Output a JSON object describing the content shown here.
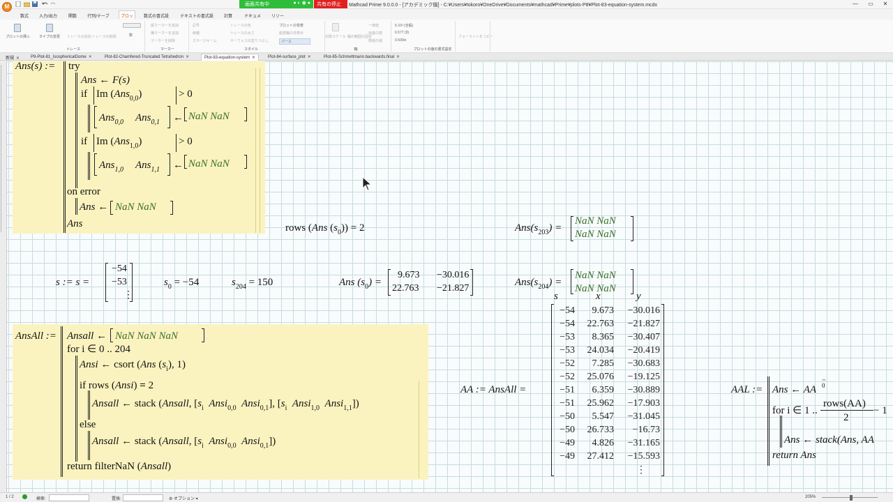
{
  "window": {
    "sharing_label": "画面共有中",
    "stop_sharing_label": "共有の停止",
    "title": "Mathcad Prime 9.0.0.0 - [アカデミック版] - C:¥Users¥tokoro¥OneDrive¥Documents¥mathcad¥Prime¥plots-P8¥Plot-83-equation-system.mcdx"
  },
  "ribbon_tabs": [
    "数式",
    "入力/出力",
    "関数",
    "行列/テーブル",
    "プロット",
    "数式の書式設定",
    "テキストの書式設定",
    "計算",
    "ドキュメント",
    "リソース"
  ],
  "active_ribbon_tab": "プロット",
  "ribbon": {
    "insert_plot": "プロットの挿入",
    "change_type": "タイプの変更",
    "add_trace": "トレースの追加",
    "remove_trace": "トレースの削除",
    "trace_group": "トレース",
    "number_label": "数",
    "add_vmarker": "縦マーカーを追加",
    "add_hmarker": "横マーカーを追加",
    "delete_marker": "マーカーを削除",
    "marker_group": "マーカー",
    "col1": [
      "記号",
      "線種",
      "カラースキーム"
    ],
    "col2": [
      "トレースの色",
      "トレースの太さ",
      "サーフェスの塗りつぶし"
    ],
    "style_group": "スタイル",
    "plot_bg": "プロットの背景",
    "bg_hide": "座標軸の非表示",
    "parse": "パース",
    "logscale": "対数スケール",
    "scale_fixed": "軸の範囲の固定",
    "col3": [
      "一様値",
      "目盛の数",
      "数値の値"
    ],
    "scale_group": "軸",
    "precision": "5-10³ (全般)",
    "value1": "6.577 (9)",
    "value2": "0.500in",
    "format_group": "プロットの値の書式設定",
    "format_copy": "フォーマットをコピー"
  },
  "doc_tabs": [
    "新規",
    "P9-Plot-81_IsosphericalDome",
    "Plot-82-Chamfered-Truncated Tetrahedron",
    "Plot-83-equation-system",
    "Plot-84-surface_plot",
    "Plot-85-Schmettmann.backwards.final"
  ],
  "active_doc_tab": "Plot-83-equation-system",
  "math": {
    "ans_def": "Ans(s) :=",
    "try": "try",
    "ans_assign": "Ans ← F(s)",
    "if_label": "if",
    "im_label": "Im",
    "ans_word": "Ans",
    "gt_zero": "> 0",
    "nan_pair": "NaN  NaN",
    "nan": "NaN",
    "sub00": "0,0",
    "sub01": "0,1",
    "sub10": "1,0",
    "sub11": "1,1",
    "on_error": "on error",
    "ans_final": "Ans",
    "rows_expr": "rows(Ans(s₀)) = 2",
    "ans203_label": "Ans(s",
    "ans203_sub": "203",
    "ans204_sub": "204",
    "s_def": "s := s =",
    "s_vec": [
      "−54",
      "−53",
      "⋮"
    ],
    "s0_eq": "= −54",
    "s204_eq": "= 150",
    "ans_s0_matrix": [
      [
        "9.673",
        "−30.016"
      ],
      [
        "22.763",
        "−21.827"
      ]
    ],
    "ansall_def": "AnsAll :=",
    "ansall_init": "Ansall ← [NaN  NaN  NaN]",
    "for_loop": "for i ∈ 0 .. 204",
    "ansi_assign": "Ansi ← csort(Ans(s",
    "ansi_tail": "), 1)",
    "if_rows": "if rows(Ansi) = 2",
    "stack1": "Ansall ← stack(Ansall, [s",
    "stack2": "Ansall ← stack(Ansall, [s",
    "ansi_word": "Ansi",
    "else": "else",
    "return_filter": "return filterNaN(Ansall)",
    "aa_def": "AA := AnsAll =",
    "col_headers": [
      "s",
      "x",
      "y"
    ],
    "aa_rows": [
      [
        "−54",
        "9.673",
        "−30.016"
      ],
      [
        "−54",
        "22.763",
        "−21.827"
      ],
      [
        "−53",
        "8.365",
        "−30.407"
      ],
      [
        "−53",
        "24.034",
        "−20.419"
      ],
      [
        "−52",
        "7.285",
        "−30.683"
      ],
      [
        "−52",
        "25.076",
        "−19.125"
      ],
      [
        "−51",
        "6.359",
        "−30.889"
      ],
      [
        "−51",
        "25.962",
        "−17.903"
      ],
      [
        "−50",
        "5.547",
        "−31.045"
      ],
      [
        "−50",
        "26.733",
        "−16.73"
      ],
      [
        "−49",
        "4.826",
        "−31.165"
      ],
      [
        "−49",
        "27.412",
        "−15.593"
      ]
    ],
    "aa_more": "⋮",
    "aal_def": "AAL :=",
    "aal_init": "Ans ← AA",
    "aal_for": "for i ∈ 1 ..",
    "aal_frac_num": "rows(AA)",
    "aal_frac_den": "2",
    "aal_minus": "− 1",
    "aal_stack": "Ans ← stack(Ans, AA",
    "aal_return": "return Ans"
  },
  "status": {
    "page": "1 / 2",
    "find": "検索:",
    "replace": "置換:",
    "options": "オプション",
    "zoom": "205%"
  }
}
